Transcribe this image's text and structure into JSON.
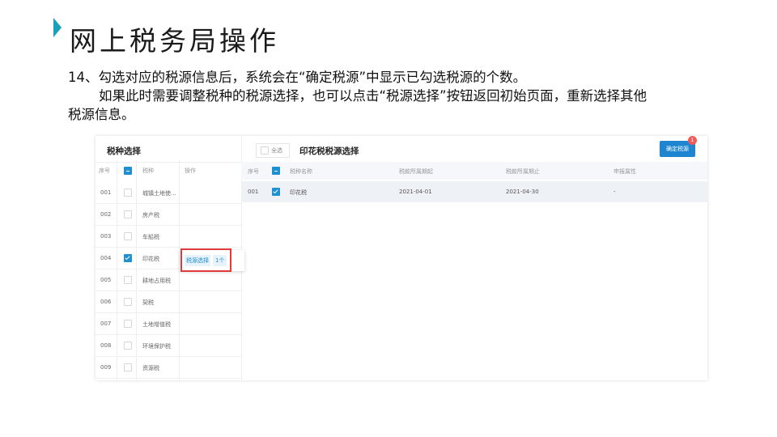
{
  "slide": {
    "title": "网上税务局操作",
    "line1": "14、勾选对应的税源信息后，系统会在“确定税源”中显示已勾选税源的个数。",
    "line2": "如果此时需要调整税种的税源选择，也可以点击“税源选择”按钮返回初始页面，重新选择其他",
    "line3": "税源信息。"
  },
  "left_panel": {
    "title": "税种选择",
    "headers": {
      "seq": "序号",
      "tax": "税种",
      "op": "操作"
    },
    "rows": [
      {
        "seq": "001",
        "name": "城镇土地使...",
        "checked": false
      },
      {
        "seq": "002",
        "name": "房产税",
        "checked": false
      },
      {
        "seq": "003",
        "name": "车船税",
        "checked": false
      },
      {
        "seq": "004",
        "name": "印花税",
        "checked": true
      },
      {
        "seq": "005",
        "name": "耕地占用税",
        "checked": false
      },
      {
        "seq": "006",
        "name": "契税",
        "checked": false
      },
      {
        "seq": "007",
        "name": "土地增值税",
        "checked": false
      },
      {
        "seq": "008",
        "name": "环境保护税",
        "checked": false
      },
      {
        "seq": "009",
        "name": "资源税",
        "checked": false
      }
    ],
    "popup": {
      "button": "税源选择",
      "count": "1个"
    }
  },
  "right_panel": {
    "select_all": "全选",
    "title": "印花税税源选择",
    "confirm_button": "确定税源",
    "badge": "1",
    "headers": [
      "序号",
      "税种名称",
      "税款所属期起",
      "税款所属期止",
      "申报属性"
    ],
    "rows": [
      {
        "seq": "001",
        "name": "印花税",
        "start": "2021-04-01",
        "end": "2021-04-30",
        "attr": "-",
        "checked": true
      }
    ]
  },
  "colors": {
    "accent": "#1e86d1",
    "highlight": "#e03a3a",
    "marker": "#1aa0b8"
  }
}
